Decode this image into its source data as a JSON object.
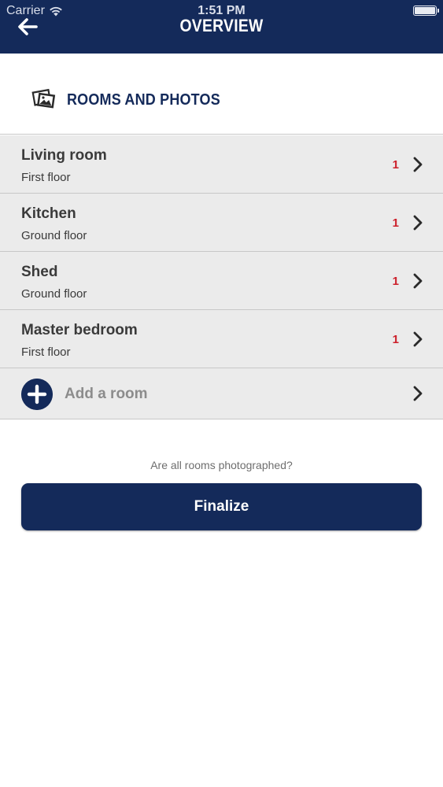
{
  "status_bar": {
    "carrier": "Carrier",
    "time": "1:51 PM"
  },
  "header": {
    "title": "OVERVIEW",
    "back_icon": "arrow-left-icon",
    "background_color": "#142a5a"
  },
  "section": {
    "title": "ROOMS AND PHOTOS",
    "icon": "photos-icon"
  },
  "rooms": [
    {
      "name": "Living room",
      "floor": "First floor",
      "count": "1"
    },
    {
      "name": "Kitchen",
      "floor": "Ground floor",
      "count": "1"
    },
    {
      "name": "Shed",
      "floor": "Ground floor",
      "count": "1"
    },
    {
      "name": "Master bedroom",
      "floor": "First floor",
      "count": "1"
    }
  ],
  "add_room": {
    "label": "Add a room",
    "icon": "plus-circle-icon"
  },
  "footer": {
    "question": "Are all rooms photographed?",
    "finalize_label": "Finalize"
  },
  "colors": {
    "accent": "#142a5a",
    "count": "#cc1f2a",
    "list_background": "#ebebeb"
  }
}
